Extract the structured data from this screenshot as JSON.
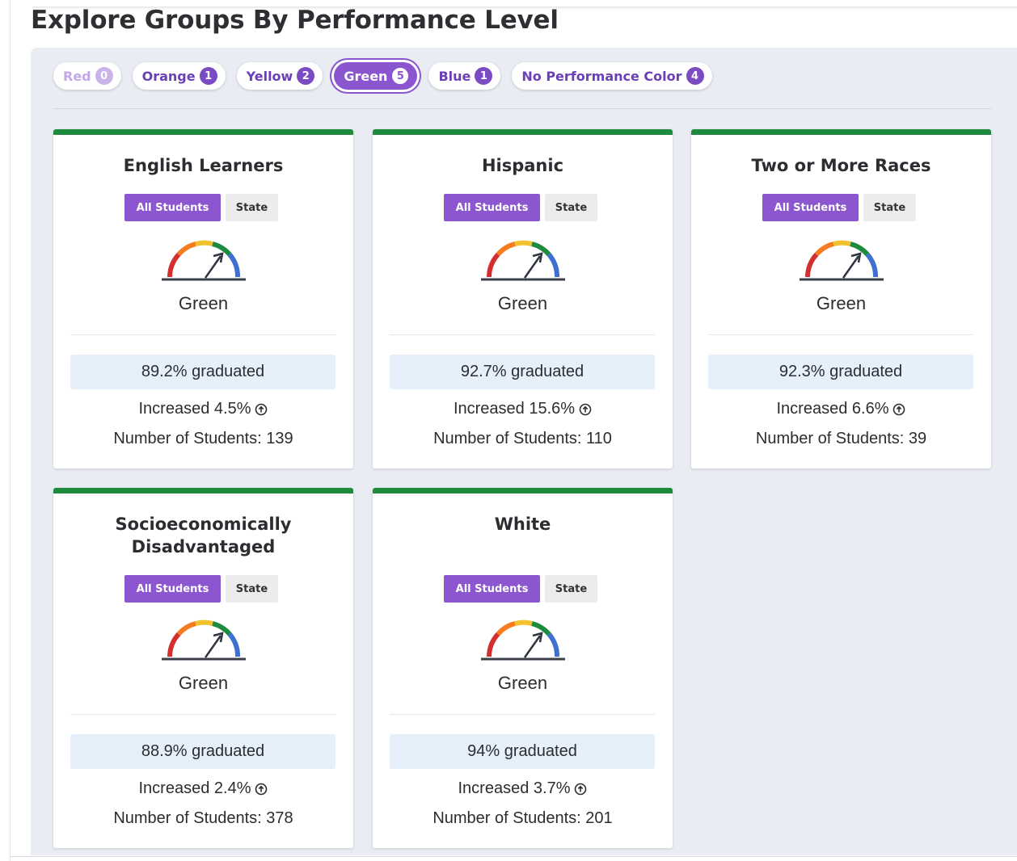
{
  "page": {
    "title": "Explore Groups By Performance Level"
  },
  "filters": [
    {
      "label": "Red",
      "count": "0",
      "state": "disabled"
    },
    {
      "label": "Orange",
      "count": "1",
      "state": "normal"
    },
    {
      "label": "Yellow",
      "count": "2",
      "state": "normal"
    },
    {
      "label": "Green",
      "count": "5",
      "state": "active"
    },
    {
      "label": "Blue",
      "count": "1",
      "state": "normal"
    },
    {
      "label": "No Performance Color",
      "count": "4",
      "state": "normal"
    }
  ],
  "toggle": {
    "all_students_label": "All Students",
    "state_label": "State"
  },
  "colors": {
    "accent_purple": "#8b56cf",
    "green_status": "#1e8a3e",
    "gauge_red": "#d32f2f",
    "gauge_orange": "#f57c20",
    "gauge_yellow": "#f2c12e",
    "gauge_green": "#1e8a3e",
    "gauge_blue": "#3f6fd1"
  },
  "icons": {
    "gauge": "performance-gauge-icon",
    "increase": "circle-arrow-up-icon"
  },
  "cards": [
    {
      "title": "English Learners",
      "level": "Green",
      "graduated": "89.2% graduated",
      "change": "Increased 4.5%",
      "students": "Number of Students: 139"
    },
    {
      "title": "Hispanic",
      "level": "Green",
      "graduated": "92.7% graduated",
      "change": "Increased 15.6%",
      "students": "Number of Students: 110"
    },
    {
      "title": "Two or More Races",
      "level": "Green",
      "graduated": "92.3% graduated",
      "change": "Increased 6.6%",
      "students": "Number of Students: 39"
    },
    {
      "title": "Socioeconomically Disadvantaged",
      "level": "Green",
      "graduated": "88.9% graduated",
      "change": "Increased 2.4%",
      "students": "Number of Students: 378"
    },
    {
      "title": "White",
      "level": "Green",
      "graduated": "94% graduated",
      "change": "Increased 3.7%",
      "students": "Number of Students: 201"
    }
  ]
}
